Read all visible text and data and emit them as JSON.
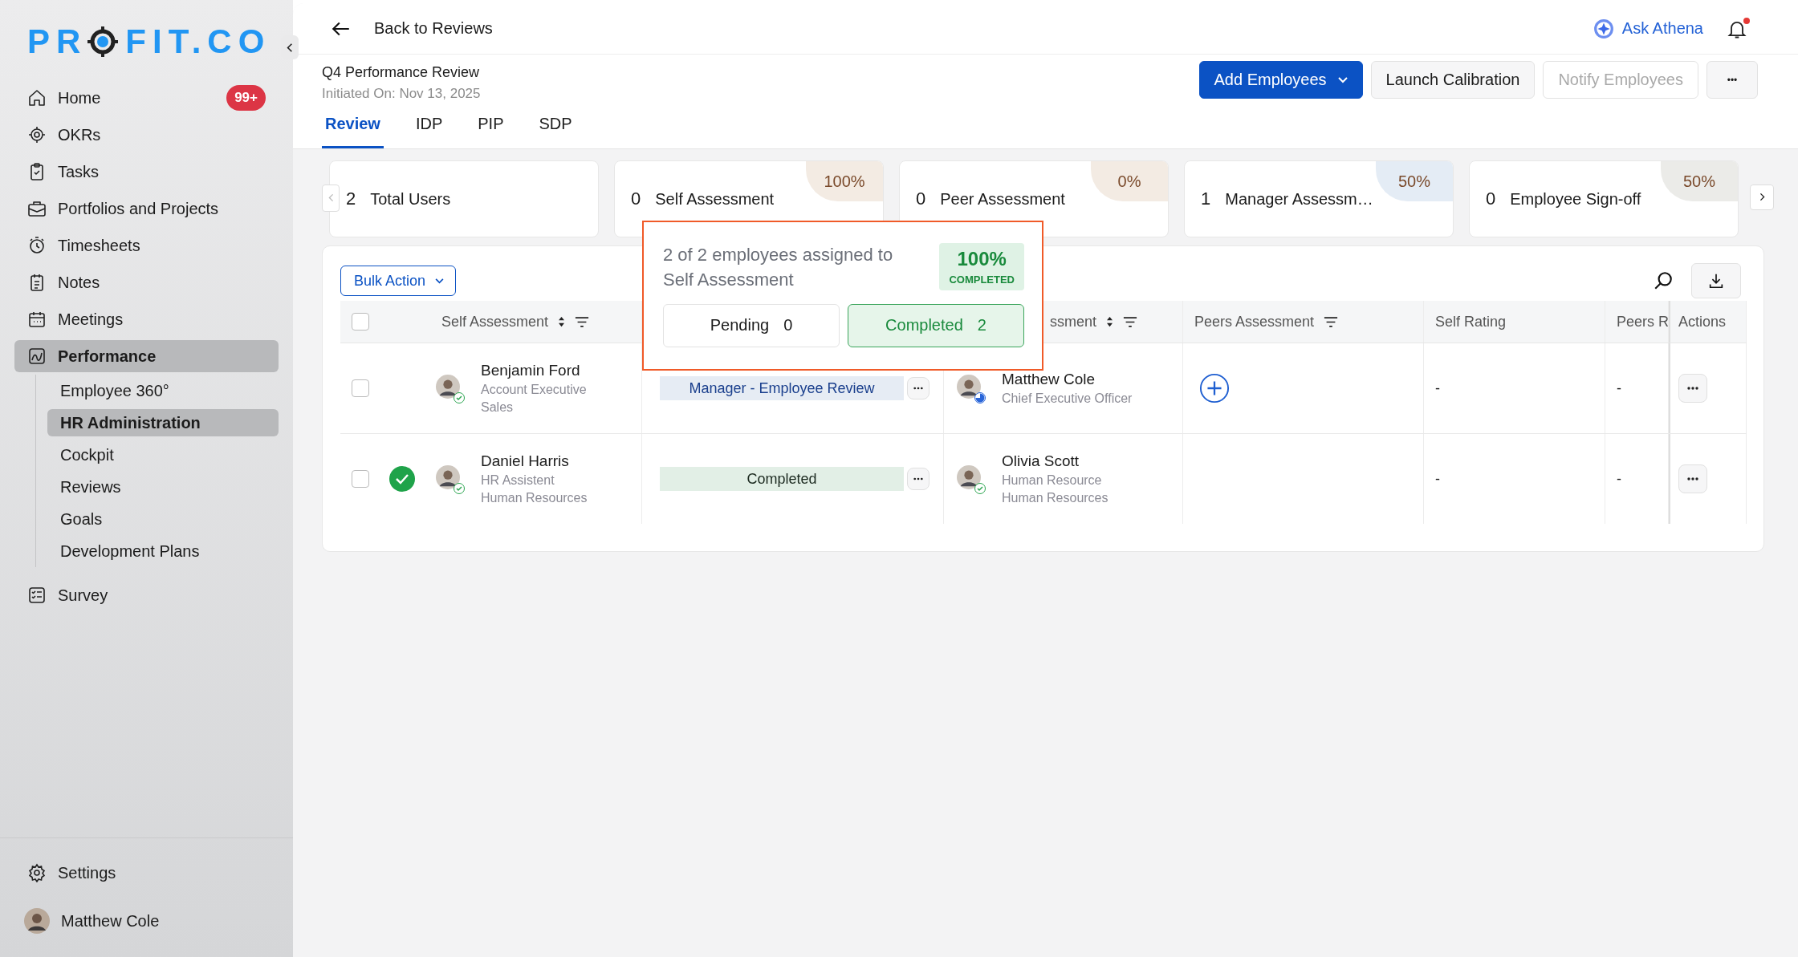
{
  "logo": {
    "before": "PR",
    "after": "FIT.CO"
  },
  "sidebar": {
    "items": [
      {
        "label": "Home",
        "badge": "99+",
        "selected": false
      },
      {
        "label": "OKRs",
        "selected": false
      },
      {
        "label": "Tasks",
        "selected": false
      },
      {
        "label": "Portfolios and Projects",
        "selected": false
      },
      {
        "label": "Timesheets",
        "selected": false
      },
      {
        "label": "Notes",
        "selected": false
      },
      {
        "label": "Meetings",
        "selected": false
      },
      {
        "label": "Performance",
        "selected": true,
        "expanded": true,
        "children": [
          {
            "label": "Employee 360°",
            "selected": false
          },
          {
            "label": "HR Administration",
            "selected": true
          },
          {
            "label": "Cockpit",
            "selected": false
          },
          {
            "label": "Reviews",
            "selected": false
          },
          {
            "label": "Goals",
            "selected": false
          },
          {
            "label": "Development Plans",
            "selected": false
          }
        ]
      },
      {
        "label": "Survey",
        "selected": false
      }
    ],
    "settings": "Settings",
    "user": "Matthew Cole"
  },
  "header": {
    "back": "Back to Reviews",
    "assistant": "Ask Athena",
    "notification_dot": true
  },
  "review": {
    "title": "Q4 Performance Review",
    "initiated": "Initiated On: Nov 13, 2025"
  },
  "actions": [
    {
      "label": "Add Employees",
      "kind": "primary",
      "disabled": false
    },
    {
      "label": "Launch Calibration",
      "kind": "secondary",
      "disabled": false
    },
    {
      "label": "Notify Employees",
      "kind": "secondary",
      "disabled": true
    },
    {
      "label": "•••",
      "kind": "more",
      "disabled": false
    }
  ],
  "tabs": [
    {
      "label": "Review",
      "selected": true
    },
    {
      "label": "IDP",
      "selected": false
    },
    {
      "label": "PIP",
      "selected": false
    },
    {
      "label": "SDP",
      "selected": false
    }
  ],
  "stats": [
    {
      "count": "2",
      "label": "Total Users"
    },
    {
      "count": "0",
      "label": "Self Assessment",
      "percent": "100%",
      "color": "#f3ebe3"
    },
    {
      "count": "0",
      "label": "Peer Assessment",
      "percent": "0%",
      "color": "#f3ebe3"
    },
    {
      "count": "1",
      "label": "Manager Assessm…",
      "percent": "50%",
      "color": "#e4ecf5"
    },
    {
      "count": "0",
      "label": "Employee Sign-off",
      "percent": "50%",
      "color": "#ebebe8"
    }
  ],
  "bulk_action": "Bulk Action",
  "table": {
    "header_checked": false,
    "columns": [
      {
        "label": "Self Assessment",
        "sortable": true,
        "filterable": true
      },
      {
        "label": "ssment",
        "sortable": true,
        "filterable": true
      },
      {
        "label": "Peers Assessment",
        "sortable": false,
        "filterable": true
      },
      {
        "label": "Self Rating",
        "sortable": false,
        "filterable": false
      },
      {
        "label": "Peers R",
        "sortable": false,
        "filterable": false
      },
      {
        "label": "Actions",
        "sortable": false,
        "filterable": false
      }
    ],
    "rows": [
      {
        "checked": false,
        "done": false,
        "employee": {
          "name": "Benjamin Ford",
          "lines": [
            "Account Executive",
            "Sales"
          ],
          "badge_complete": true
        },
        "stage": {
          "label": "Manager - Employee Review",
          "kind": "progress"
        },
        "manager": {
          "name": "Matthew Cole",
          "lines": [
            "Chief Executive Officer"
          ],
          "badge_complete": false
        },
        "peers_add": true,
        "self_rating": "-",
        "peers_rating": "-"
      },
      {
        "checked": false,
        "done": true,
        "employee": {
          "name": "Daniel Harris",
          "lines": [
            "HR Assistent",
            "Human Resources"
          ],
          "badge_complete": true
        },
        "stage": {
          "label": "Completed",
          "kind": "completed"
        },
        "manager": {
          "name": "Olivia Scott",
          "lines": [
            "Human Resource",
            "Human Resources"
          ],
          "badge_complete": true
        },
        "peers_add": false,
        "self_rating": "-",
        "peers_rating": "-"
      }
    ]
  },
  "popup": {
    "text": "2 of 2 employees assigned to Self Assessment",
    "percent": "100%",
    "status": "COMPLETED",
    "filters": [
      {
        "label": "Pending",
        "count": "0",
        "selected": false
      },
      {
        "label": "Completed",
        "count": "2",
        "selected": true
      }
    ]
  }
}
